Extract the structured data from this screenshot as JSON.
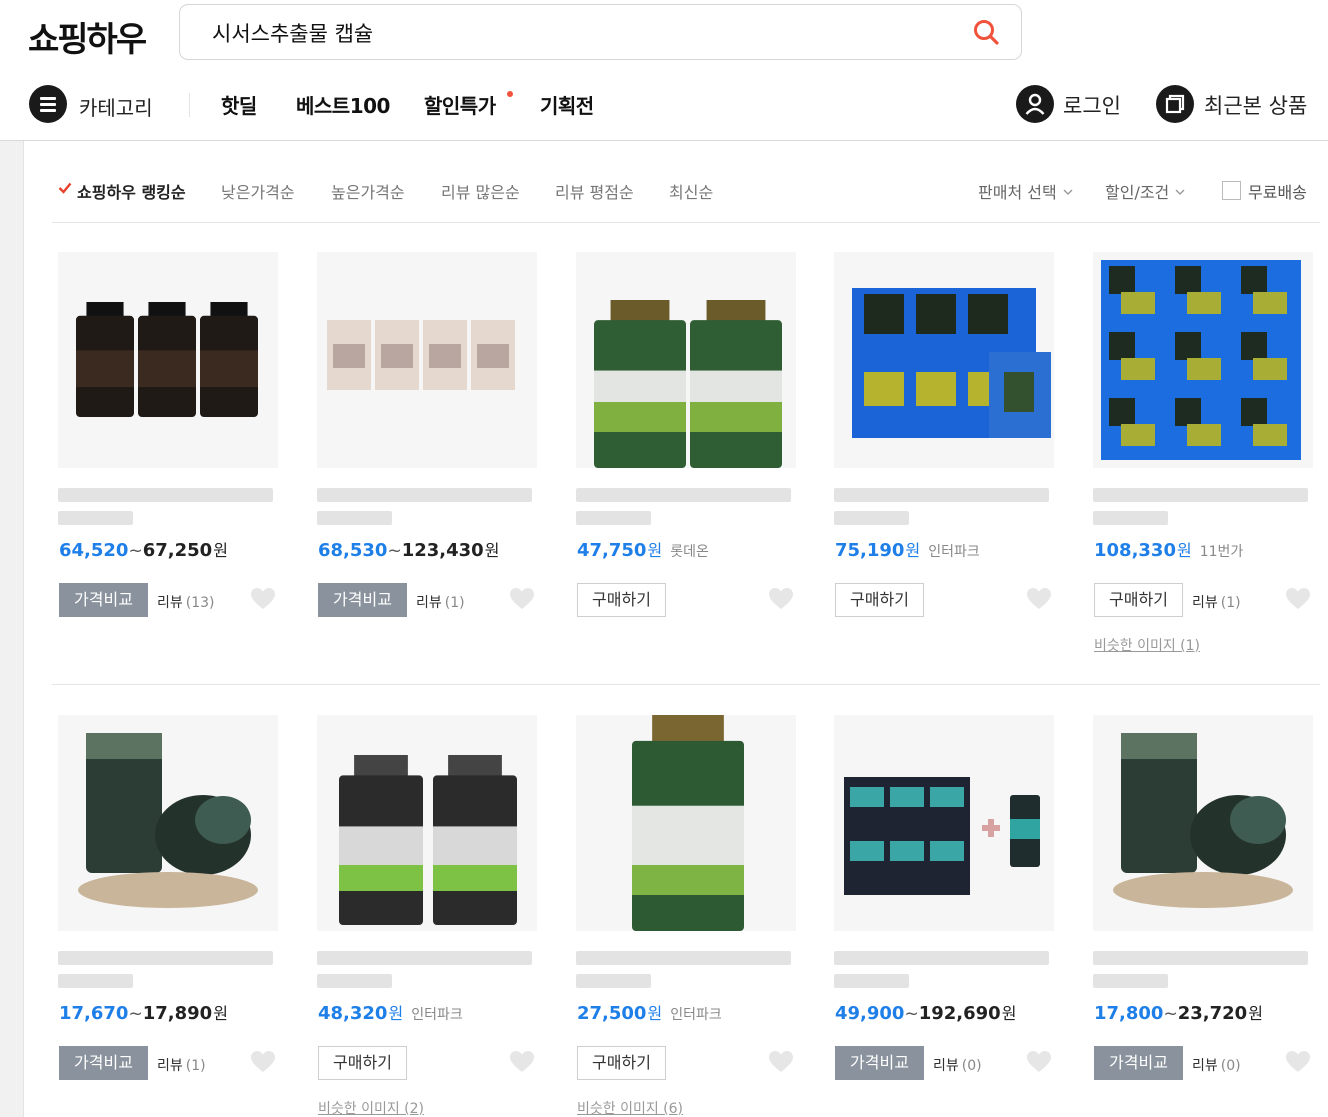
{
  "header": {
    "logo": "쇼핑하우",
    "search_value": "시서스추출물 캡슐",
    "category_label": "카테고리",
    "nav_links": [
      "핫딜",
      "베스트100",
      "할인특가",
      "기획전"
    ],
    "login_label": "로그인",
    "recent_label": "최근본 상품"
  },
  "sort": {
    "options": [
      "쇼핑하우 랭킹순",
      "낮은가격순",
      "높은가격순",
      "리뷰 많은순",
      "리뷰 평점순",
      "최신순"
    ],
    "active": "쇼핑하우 랭킹순",
    "seller_filter": "판매처 선택",
    "discount_filter": "할인/조건",
    "free_shipping": "무료배송"
  },
  "colors": {
    "price_blue": "#1f7fe8",
    "compare_button": "#8a939d",
    "new_dot": "#f0523c",
    "search_icon": "#f0523c"
  },
  "icons": {
    "search": "magnifier-icon",
    "category": "hamburger-menu-icon",
    "login": "user-icon",
    "recent": "recent-items-icon",
    "wish": "heart-icon",
    "check": "checkmark-icon"
  },
  "products": [
    {
      "price_min": "64,520",
      "price_max": "67,250",
      "currency": "원",
      "seller": "",
      "button": "가격비교",
      "review_label": "리뷰",
      "review_count": "(13)",
      "similar": ""
    },
    {
      "price_min": "68,530",
      "price_max": "123,430",
      "currency": "원",
      "seller": "",
      "button": "가격비교",
      "review_label": "리뷰",
      "review_count": "(1)",
      "similar": ""
    },
    {
      "price_min": "47,750",
      "price_max": "",
      "currency": "원",
      "seller": "롯데온",
      "button": "구매하기",
      "review_label": "",
      "review_count": "",
      "similar": ""
    },
    {
      "price_min": "75,190",
      "price_max": "",
      "currency": "원",
      "seller": "인터파크",
      "button": "구매하기",
      "review_label": "",
      "review_count": "",
      "similar": ""
    },
    {
      "price_min": "108,330",
      "price_max": "",
      "currency": "원",
      "seller": "11번가",
      "button": "구매하기",
      "review_label": "리뷰",
      "review_count": "(1)",
      "similar": "비슷한 이미지 (1)"
    },
    {
      "price_min": "17,670",
      "price_max": "17,890",
      "currency": "원",
      "seller": "",
      "button": "가격비교",
      "review_label": "리뷰",
      "review_count": "(1)",
      "similar": ""
    },
    {
      "price_min": "48,320",
      "price_max": "",
      "currency": "원",
      "seller": "인터파크",
      "button": "구매하기",
      "review_label": "",
      "review_count": "",
      "similar": "비슷한 이미지 (2)"
    },
    {
      "price_min": "27,500",
      "price_max": "",
      "currency": "원",
      "seller": "인터파크",
      "button": "구매하기",
      "review_label": "",
      "review_count": "",
      "similar": "비슷한 이미지 (6)"
    },
    {
      "price_min": "49,900",
      "price_max": "192,690",
      "currency": "원",
      "seller": "",
      "button": "가격비교",
      "review_label": "리뷰",
      "review_count": "(0)",
      "similar": ""
    },
    {
      "price_min": "17,800",
      "price_max": "23,720",
      "currency": "원",
      "seller": "",
      "button": "가격비교",
      "review_label": "리뷰",
      "review_count": "(0)",
      "similar": ""
    }
  ]
}
